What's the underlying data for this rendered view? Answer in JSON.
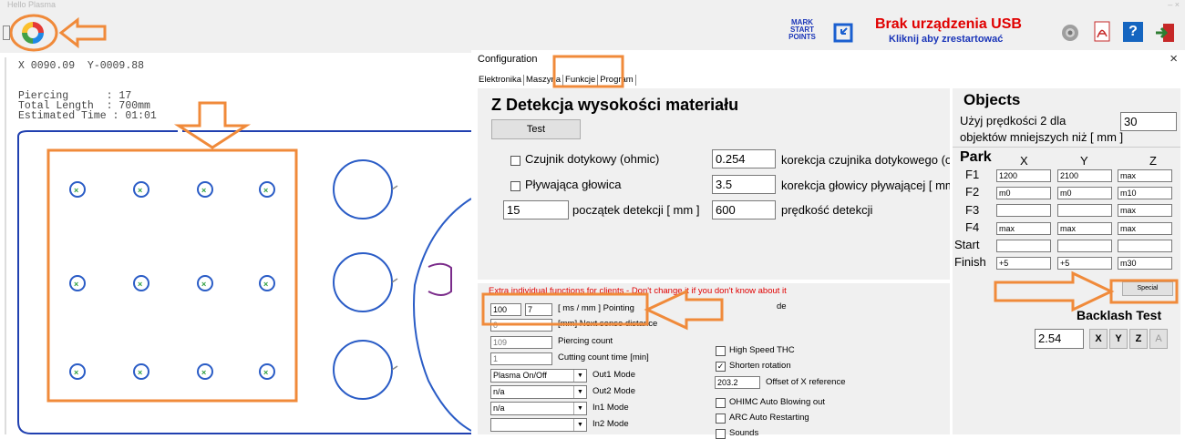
{
  "window": {
    "title": "Hello Plasma",
    "controls": "–  ×"
  },
  "toolbar": {
    "mark_start_points": "MARK\nSTART\nPOINTS",
    "usb_status": "Brak urządzenia USB",
    "usb_restart": "Kliknij aby zrestartować"
  },
  "left": {
    "coords": "X 0090.09  Y-0009.88",
    "piercing": "Piercing      : 17",
    "total_length": "Total Length  : 700mm",
    "estimated_time": "Estimated Time : 01:01"
  },
  "config": {
    "title": "Configuration",
    "close": "×",
    "tabs": [
      "Elektronika",
      "Maszyna",
      "Funkcje",
      "Program"
    ],
    "z_heading": "Z Detekcja wysokości materiału",
    "test_btn": "Test",
    "ohmic_label": "Czujnik dotykowy (ohmic)",
    "floating_label": "Pływająca głowica",
    "ohmic_corr_value": "0.254",
    "ohmic_corr_label": "korekcja czujnika dotykowego (oh",
    "float_corr_value": "3.5",
    "float_corr_label": "korekcja głowicy pływającej [ mm",
    "det_start_value": "15",
    "det_start_label": "początek detekcji [ mm ]",
    "det_speed_value": "600",
    "det_speed_label": "prędkość detekcji",
    "objects_heading": "Objects",
    "objects_text1": "Użyj prędkości 2 dla",
    "objects_text2": "objektów mniejszych niż [ mm ]",
    "objects_value": "30",
    "park_heading": "Park",
    "park_cols": [
      "X",
      "Y",
      "Z"
    ],
    "park_rows": [
      {
        "label": "F1",
        "x": "1200",
        "y": "2100",
        "z": "max"
      },
      {
        "label": "F2",
        "x": "m0",
        "y": "m0",
        "z": "m10"
      },
      {
        "label": "F3",
        "x": "",
        "y": "",
        "z": "max"
      },
      {
        "label": "F4",
        "x": "max",
        "y": "max",
        "z": "max"
      },
      {
        "label": "Start",
        "x": "",
        "y": "",
        "z": ""
      },
      {
        "label": "Finish",
        "x": "+5",
        "y": "+5",
        "z": "m30"
      }
    ],
    "special_btn": "Special",
    "backlash_heading": "Backlash Test",
    "backlash_value": "2.54",
    "backlash_btns": [
      "X",
      "Y",
      "Z",
      "A"
    ],
    "extra_warning": "Extra individual functions for clients - Don't change it if you don't know about it !!!",
    "pointing_a": "100",
    "pointing_b": "7",
    "pointing_label": "[ ms / mm ] Pointing",
    "next_sense_value": "0",
    "next_sense_label": "[mm] Next sense distance",
    "piercing_count_value": "109",
    "piercing_count_label": "Piercing count",
    "cutting_count_value": "1",
    "cutting_count_label": "Cutting count time [min]",
    "out1_value": "Plasma On/Off",
    "out1_label": "Out1 Mode",
    "out2_value": "n/a",
    "out2_label": "Out2 Mode",
    "in1_value": "n/a",
    "in1_label": "In1 Mode",
    "in2_value": "",
    "in2_label": "In2 Mode",
    "partial_de": "de",
    "hs_thc": "High Speed THC",
    "shorten": "Shorten rotation",
    "offset_value": "203.2",
    "offset_label": "Offset of X reference",
    "ohimc": "OHIMC Auto Blowing out",
    "arc": "ARC Auto Restarting",
    "sounds": "Sounds"
  },
  "colors": {
    "accent_orange": "#f08a3a",
    "status_red": "#e00000",
    "link_blue": "#1a35b8",
    "drawing_blue": "#2a5cc6"
  }
}
